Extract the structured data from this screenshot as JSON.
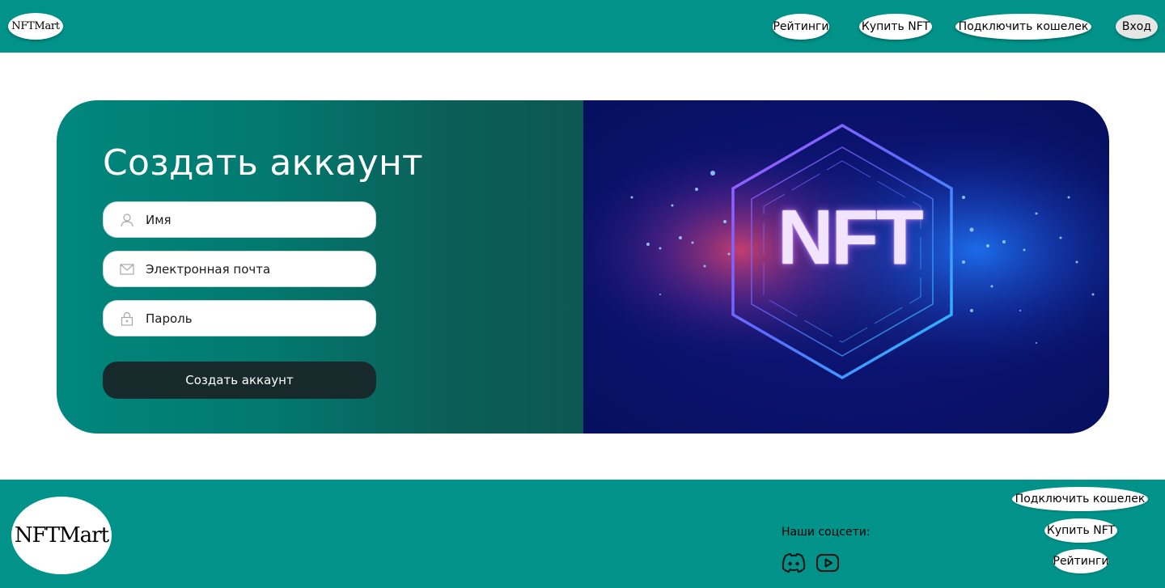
{
  "header": {
    "logo": "NFTMart",
    "nav": {
      "ratings": "Рейтинги",
      "buy": "Купить NFT",
      "wallet": "Подключить кошелек",
      "login": "Вход"
    }
  },
  "form": {
    "title": "Создать аккаунт",
    "fields": {
      "name": "Имя",
      "email": "Электронная почта",
      "password": "Пароль"
    },
    "submit": "Создать аккаунт"
  },
  "hero": {
    "text": "NFT"
  },
  "footer": {
    "logo": "NFTMart",
    "social_label": "Наши соцсети:",
    "social_icons": [
      "discord-icon",
      "youtube-icon"
    ],
    "links": {
      "wallet": "Подключить кошелек",
      "buy": "Купить NFT",
      "ratings": "Рейтинги"
    }
  },
  "colors": {
    "brand": "#019289",
    "button": "#17292b",
    "hero_bg": "#0b1370"
  }
}
